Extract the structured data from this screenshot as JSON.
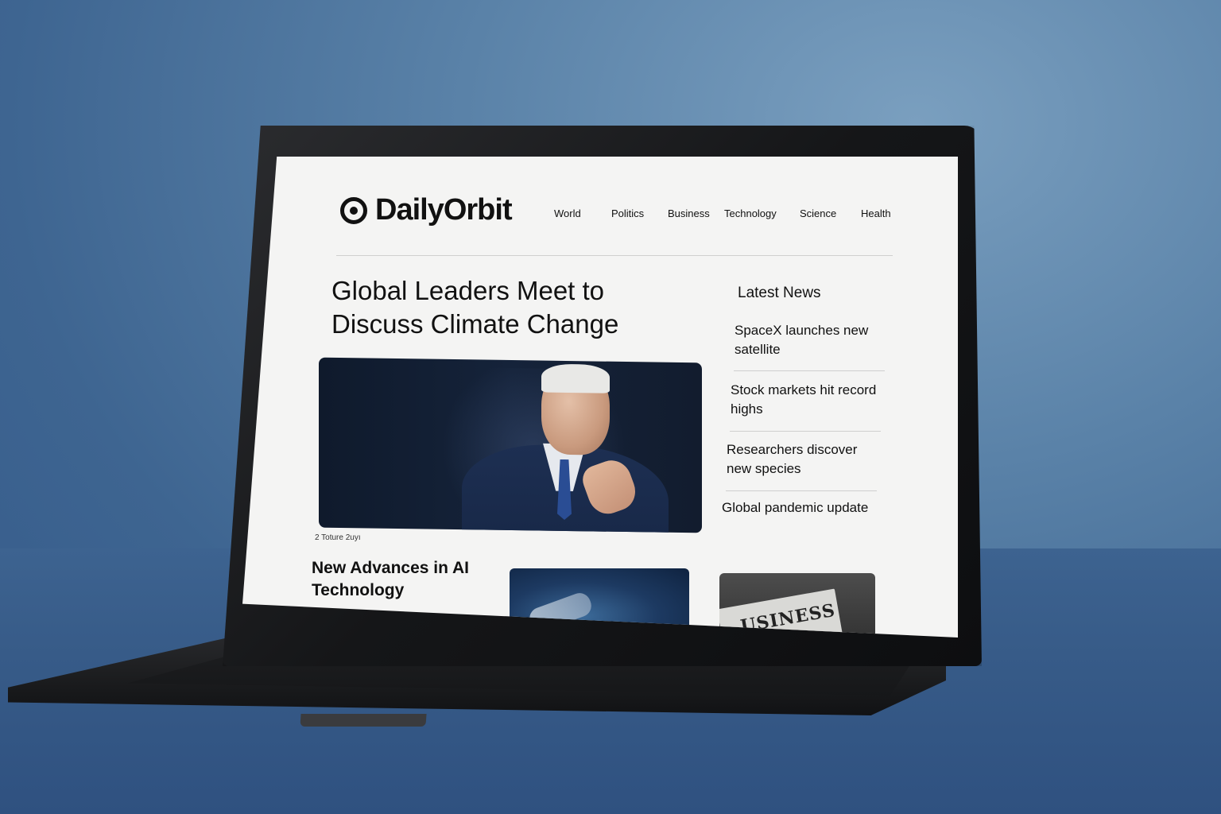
{
  "site": {
    "name": "DailyOrbit"
  },
  "nav": {
    "items": [
      "World",
      "Politics",
      "Business",
      "Technology",
      "Science",
      "Health"
    ]
  },
  "main": {
    "headline": "Global Leaders Meet to Discuss Climate Change",
    "caption": "2 Toture 2uyı"
  },
  "sidebar": {
    "title": "Latest News",
    "items": [
      "SpaceX launches new satellite",
      "Stock markets hit record highs",
      "Researchers discover new species",
      "Global pandemic update"
    ]
  },
  "secondary": {
    "headline": "New Advances in AI Technology",
    "thumb_business_text": "USINESS"
  },
  "colors": {
    "background": "#3e6591",
    "screen": "#f4f4f3",
    "text": "#111111",
    "laptop": "#151618"
  },
  "icons": {
    "logo": "orbit-logo-icon"
  }
}
